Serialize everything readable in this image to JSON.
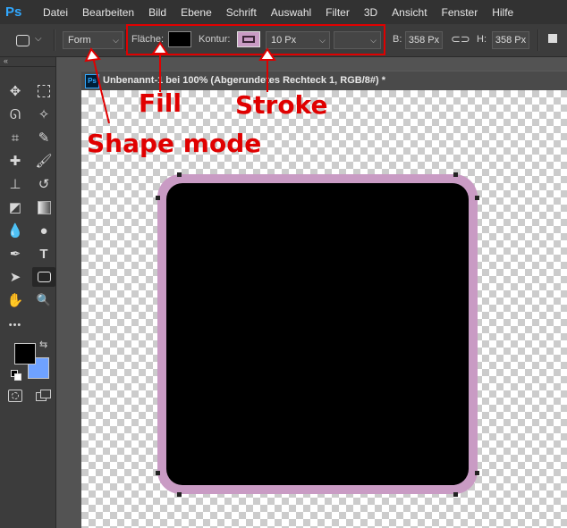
{
  "app": {
    "logo": "Ps"
  },
  "menu": [
    "Datei",
    "Bearbeiten",
    "Bild",
    "Ebene",
    "Schrift",
    "Auswahl",
    "Filter",
    "3D",
    "Ansicht",
    "Fenster",
    "Hilfe"
  ],
  "options": {
    "mode_value": "Form",
    "fill_label": "Fläche:",
    "stroke_label": "Kontur:",
    "stroke_width_value": "10 Px",
    "width_label": "B:",
    "width_value": "358 Px",
    "height_label": "H:",
    "height_value": "358 Px",
    "fill_color": "#000000",
    "stroke_color": "#c99bc4"
  },
  "tools": [
    {
      "name": "move-tool",
      "icon": "✥"
    },
    {
      "name": "marquee-tool",
      "icon": "marquee"
    },
    {
      "name": "lasso-tool",
      "icon": "ᘏ"
    },
    {
      "name": "magic-wand-tool",
      "icon": "✧"
    },
    {
      "name": "crop-tool",
      "icon": "⌗"
    },
    {
      "name": "eyedropper-tool",
      "icon": "✎"
    },
    {
      "name": "healing-brush-tool",
      "icon": "✚"
    },
    {
      "name": "brush-tool",
      "icon": "🖌"
    },
    {
      "name": "clone-stamp-tool",
      "icon": "⊥"
    },
    {
      "name": "history-brush-tool",
      "icon": "↺"
    },
    {
      "name": "eraser-tool",
      "icon": "◩"
    },
    {
      "name": "gradient-tool",
      "icon": "gradient"
    },
    {
      "name": "blur-tool",
      "icon": "💧"
    },
    {
      "name": "dodge-tool",
      "icon": "●"
    },
    {
      "name": "pen-tool",
      "icon": "✒"
    },
    {
      "name": "type-tool",
      "icon": "T"
    },
    {
      "name": "path-selection-tool",
      "icon": "➤"
    },
    {
      "name": "rounded-rectangle-tool",
      "icon": "rounded-rect"
    },
    {
      "name": "hand-tool",
      "icon": "✋"
    },
    {
      "name": "zoom-tool",
      "icon": "🔍"
    },
    {
      "name": "more-tools",
      "icon": "•••"
    }
  ],
  "colors": {
    "foreground": "#000000",
    "background": "#6fa2ff"
  },
  "document": {
    "tab_icon": "Ps",
    "title": "Unbenannt-1 bei 100% (Abgerundetes Rechteck 1, RGB/8#) *"
  },
  "shape": {
    "fill": "#000000",
    "stroke": "#c99bc4"
  },
  "annotations": {
    "fill": "Fill",
    "stroke": "Stroke",
    "shape_mode": "Shape mode",
    "color": "#e00000"
  }
}
